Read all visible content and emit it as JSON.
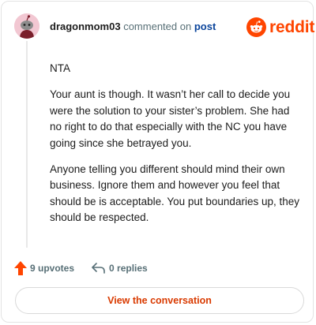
{
  "comment": {
    "username": "dragonmom03",
    "action_text": "commented on",
    "post_link_text": "post",
    "paragraphs": [
      "NTA",
      "Your aunt is though. It wasn’t her call to decide you were the solution to your sister’s problem. She had no right to do that especially with the NC you have going since she betrayed you.",
      "Anyone telling you different should mind their own business. Ignore them and however you feel that should be is acceptable. You put boundaries up, they should be respected."
    ],
    "upvotes_label": "9 upvotes",
    "replies_label": "0 replies"
  },
  "brand": {
    "logo_text": "reddit",
    "color": "#ff4500"
  },
  "cta": {
    "label": "View the conversation"
  },
  "icons": {
    "avatar": "snoo-avatar-icon",
    "logo": "reddit-snoo-icon",
    "upvote": "upvote-arrow-icon",
    "reply": "reply-arrow-icon"
  }
}
